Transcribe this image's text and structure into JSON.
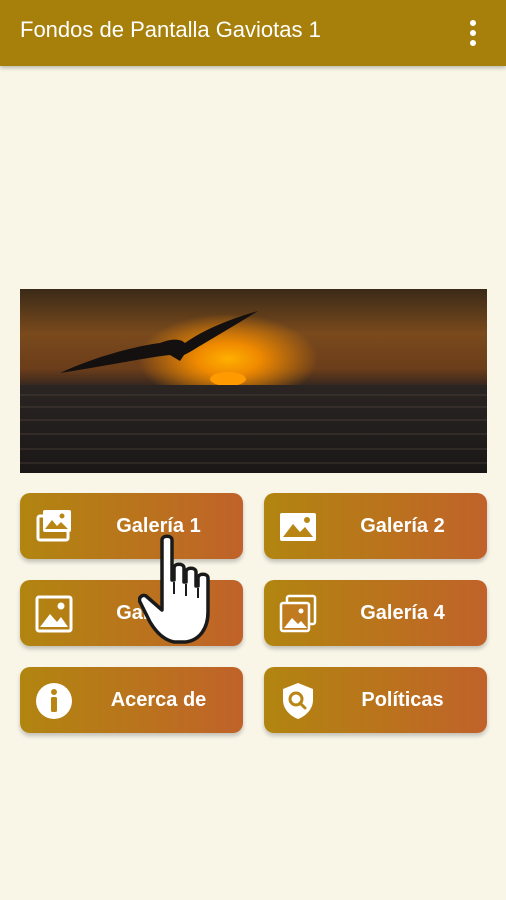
{
  "appbar": {
    "title": "Fondos de Pantalla Gaviotas 1",
    "menu_icon": "more-vert-icon"
  },
  "hero": {
    "image": "seagull-sunset-photo"
  },
  "buttons": [
    {
      "label": "Galería 1",
      "icon": "gallery-icon"
    },
    {
      "label": "Galería 2",
      "icon": "image-icon"
    },
    {
      "label": "Galería 3",
      "icon": "image-frame-icon"
    },
    {
      "label": "Galería 4",
      "icon": "image-stack-icon"
    },
    {
      "label": "Acerca de",
      "icon": "info-icon"
    },
    {
      "label": "Políticas",
      "icon": "shield-search-icon"
    }
  ],
  "overlay": {
    "pointer_icon": "pointing-hand-icon"
  },
  "colors": {
    "appbar": "#a7800b",
    "background": "#f9f6e8",
    "button_start": "#b18510",
    "button_end": "#c0622a"
  }
}
